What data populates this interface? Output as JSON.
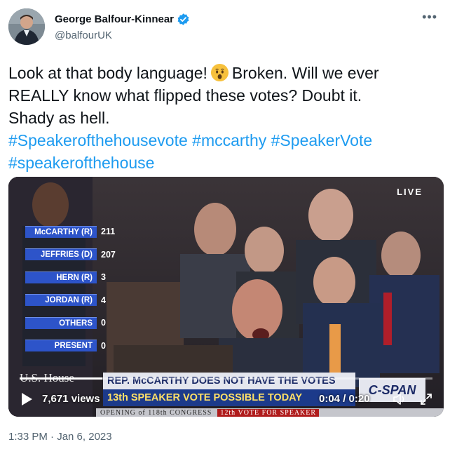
{
  "author": {
    "name": "George Balfour-Kinnear",
    "handle": "@balfourUK",
    "verified": true
  },
  "menu": {
    "more_icon": "more-horizontal-icon"
  },
  "tweet": {
    "line1_before_emoji": "Look at that body language!",
    "line1_after_emoji": "Broken. Will we ever",
    "emoji": "hushed-face-emoji",
    "line2": "REALLY know what flipped these votes? Doubt it.",
    "line3": "Shady as hell.",
    "hashtags": [
      "#Speakerofthehousevote",
      "#mccarthy",
      "#SpeakerVote",
      "#speakerofthehouse"
    ]
  },
  "video": {
    "live_label": "LIVE",
    "tally": [
      {
        "candidate": "McCARTHY (R)",
        "votes": "211"
      },
      {
        "candidate": "JEFFRIES (D)",
        "votes": "207"
      },
      {
        "candidate": "HERN (R)",
        "votes": "3"
      },
      {
        "candidate": "JORDAN (R)",
        "votes": "4"
      },
      {
        "candidate": "OTHERS",
        "votes": "0"
      },
      {
        "candidate": "PRESENT",
        "votes": "0"
      }
    ],
    "chyron_top": "REP. McCARTHY DOES NOT HAVE THE VOTES",
    "chyron_bottom": "13th SPEAKER VOTE POSSIBLE TODAY",
    "network": "C-SPAN",
    "logo_text": "U.S. House",
    "strip_text": "OPENING of 118th CONGRESS",
    "strip_red": "12th VOTE FOR SPEAKER",
    "views": "7,671 views",
    "time": "0:04 / 0:20",
    "progress": 0.2,
    "play_icon": "play-icon",
    "volume_icon": "volume-icon",
    "fullscreen_icon": "fullscreen-icon"
  },
  "timestamp": "1:33 PM · Jan 6, 2023",
  "colors": {
    "link": "#1d9bf0",
    "verified": "#1d9bf0",
    "muted": "#536471"
  }
}
